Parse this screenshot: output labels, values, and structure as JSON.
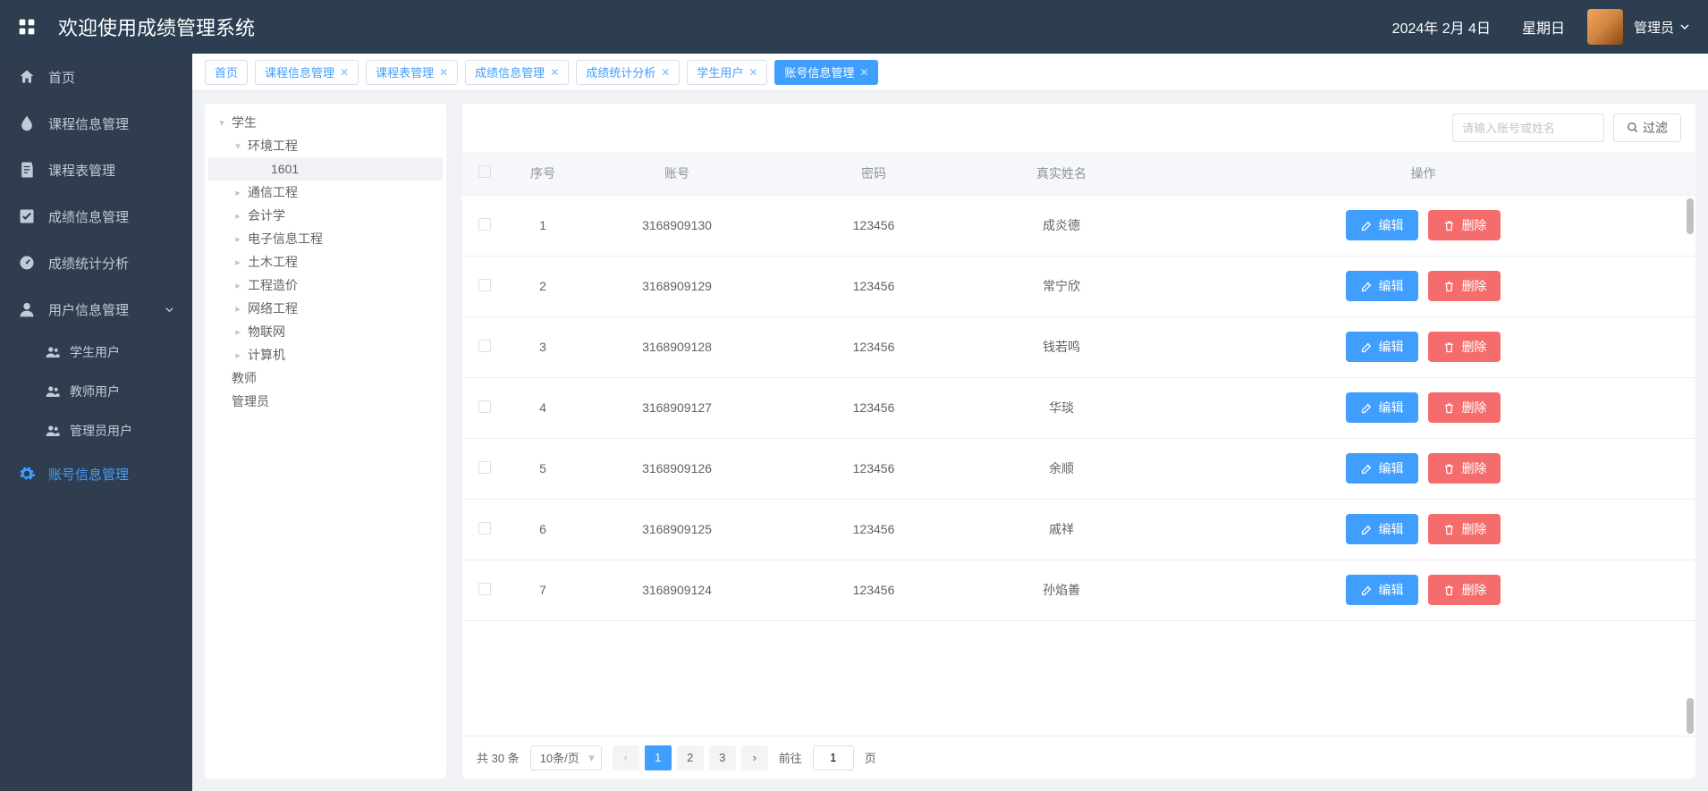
{
  "header": {
    "title": "欢迎使用成绩管理系统",
    "date": "2024年 2月 4日",
    "weekday": "星期日",
    "user_name": "管理员"
  },
  "sidebar": {
    "items": [
      {
        "icon": "home",
        "label": "首页"
      },
      {
        "icon": "drop",
        "label": "课程信息管理"
      },
      {
        "icon": "doc",
        "label": "课程表管理"
      },
      {
        "icon": "check",
        "label": "成绩信息管理"
      },
      {
        "icon": "dashboard",
        "label": "成绩统计分析"
      },
      {
        "icon": "user",
        "label": "用户信息管理",
        "expandable": true,
        "children": [
          {
            "label": "学生用户"
          },
          {
            "label": "教师用户"
          },
          {
            "label": "管理员用户"
          }
        ]
      },
      {
        "icon": "gear",
        "label": "账号信息管理",
        "active": true
      }
    ]
  },
  "tabs": [
    {
      "label": "首页",
      "closable": false
    },
    {
      "label": "课程信息管理",
      "closable": true
    },
    {
      "label": "课程表管理",
      "closable": true
    },
    {
      "label": "成绩信息管理",
      "closable": true
    },
    {
      "label": "成绩统计分析",
      "closable": true
    },
    {
      "label": "学生用户",
      "closable": true
    },
    {
      "label": "账号信息管理",
      "closable": true,
      "active": true
    }
  ],
  "tree": [
    {
      "label": "学生",
      "indent": 0,
      "expanded": true
    },
    {
      "label": "环境工程",
      "indent": 1,
      "expanded": true
    },
    {
      "label": "1601",
      "indent": 2,
      "leaf": true,
      "selected": true
    },
    {
      "label": "通信工程",
      "indent": 1,
      "leaf": false
    },
    {
      "label": "会计学",
      "indent": 1,
      "leaf": false
    },
    {
      "label": "电子信息工程",
      "indent": 1,
      "leaf": false
    },
    {
      "label": "土木工程",
      "indent": 1,
      "leaf": false
    },
    {
      "label": "工程造价",
      "indent": 1,
      "leaf": false
    },
    {
      "label": "网络工程",
      "indent": 1,
      "leaf": false
    },
    {
      "label": "物联网",
      "indent": 1,
      "leaf": false
    },
    {
      "label": "计算机",
      "indent": 1,
      "leaf": false
    },
    {
      "label": "教师",
      "indent": 0,
      "leaf": true
    },
    {
      "label": "管理员",
      "indent": 0,
      "leaf": true
    }
  ],
  "filter": {
    "placeholder": "请输入账号或姓名",
    "button": "过滤"
  },
  "table": {
    "headers": {
      "idx": "序号",
      "account": "账号",
      "password": "密码",
      "realname": "真实姓名",
      "ops": "操作"
    },
    "edit_label": "编辑",
    "delete_label": "删除",
    "rows": [
      {
        "idx": "1",
        "account": "3168909130",
        "password": "123456",
        "realname": "成炎德"
      },
      {
        "idx": "2",
        "account": "3168909129",
        "password": "123456",
        "realname": "常宁欣"
      },
      {
        "idx": "3",
        "account": "3168909128",
        "password": "123456",
        "realname": "钱若鸣"
      },
      {
        "idx": "4",
        "account": "3168909127",
        "password": "123456",
        "realname": "华琰"
      },
      {
        "idx": "5",
        "account": "3168909126",
        "password": "123456",
        "realname": "余顺"
      },
      {
        "idx": "6",
        "account": "3168909125",
        "password": "123456",
        "realname": "戚祥"
      },
      {
        "idx": "7",
        "account": "3168909124",
        "password": "123456",
        "realname": "孙焰善"
      }
    ]
  },
  "pagination": {
    "total_label": "共 30 条",
    "page_size_label": "10条/页",
    "pages": [
      "1",
      "2",
      "3"
    ],
    "active_page": "1",
    "goto_prefix": "前往",
    "goto_value": "1",
    "goto_suffix": "页"
  }
}
